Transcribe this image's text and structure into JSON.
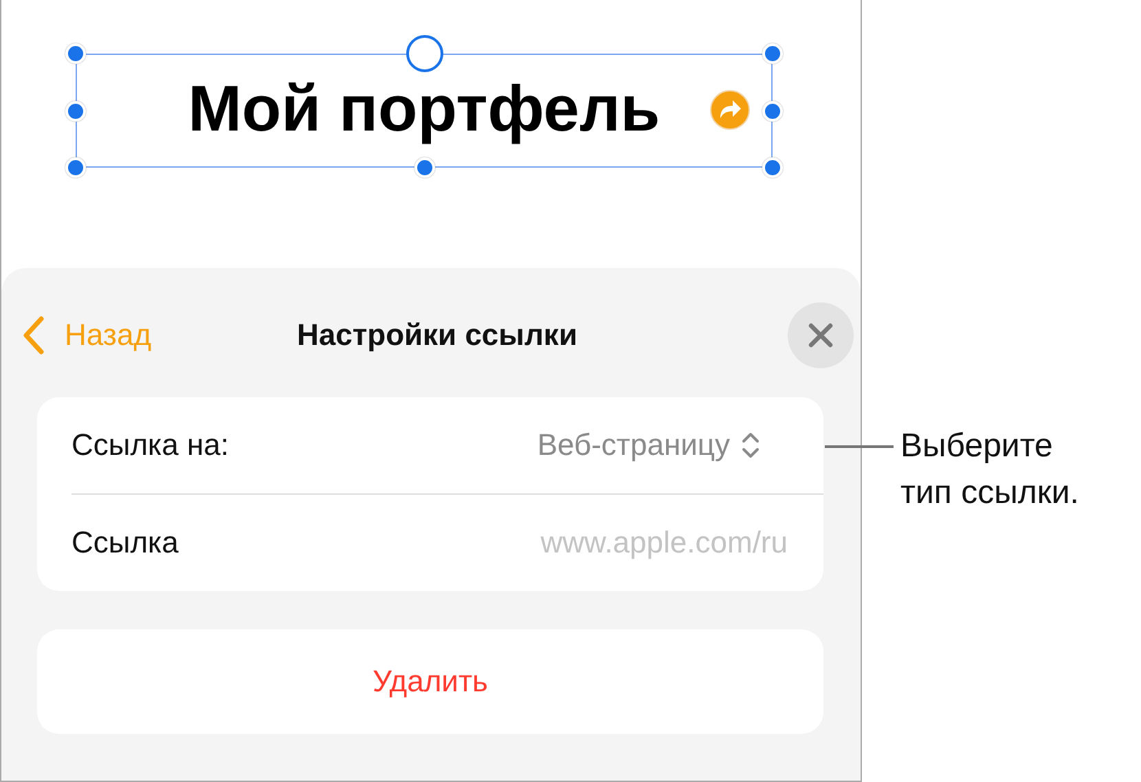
{
  "canvas": {
    "text_box": {
      "text": "Мой портфель",
      "selected": true
    }
  },
  "panel": {
    "back_button": "Назад",
    "title": "Настройки ссылки",
    "rows": [
      {
        "kind": "picker",
        "label": "Ссылка на:",
        "value": "Веб-страницу"
      },
      {
        "kind": "field",
        "label": "Ссылка",
        "placeholder": "www.apple.com/ru"
      }
    ],
    "delete_button": "Удалить"
  },
  "callout": {
    "text": "Выберите тип ссылки."
  }
}
